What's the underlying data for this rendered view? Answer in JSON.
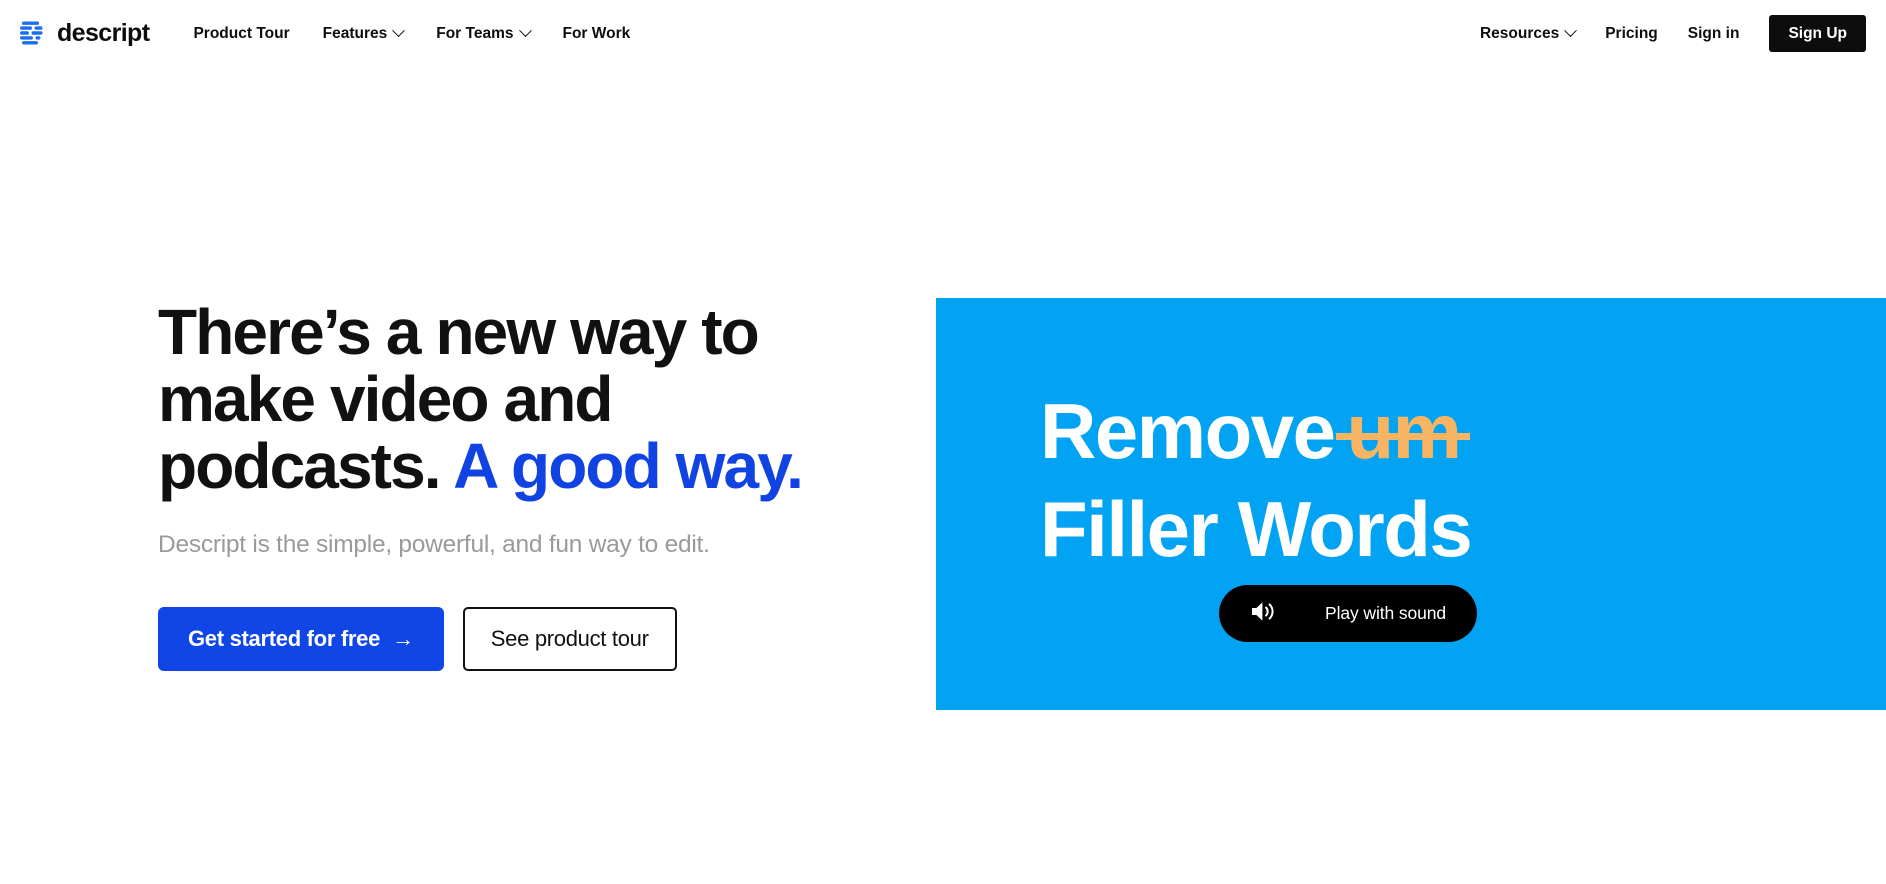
{
  "nav": {
    "brand": {
      "name": "descript",
      "logo_icon": "descript-waveform-logo"
    },
    "left_items": [
      {
        "label": "Product Tour",
        "has_dropdown": false
      },
      {
        "label": "Features",
        "has_dropdown": true,
        "icon": "chevron-down-icon"
      },
      {
        "label": "For Teams",
        "has_dropdown": true,
        "icon": "chevron-down-icon"
      },
      {
        "label": "For Work",
        "has_dropdown": false
      }
    ],
    "right_items": [
      {
        "label": "Resources",
        "has_dropdown": true,
        "icon": "chevron-down-icon"
      },
      {
        "label": "Pricing",
        "has_dropdown": false
      },
      {
        "label": "Sign in",
        "has_dropdown": false
      }
    ],
    "signup_label": "Sign Up"
  },
  "hero": {
    "headline_line1": "There’s a new way to",
    "headline_line2": "make video and",
    "headline_line3_plain": "podcasts.",
    "headline_line3_accent": "A good way.",
    "subhead": "Descript is the simple, powerful, and fun way to edit.",
    "primary_cta": "Get started for free",
    "primary_cta_arrow": "→",
    "secondary_cta": "See product tour"
  },
  "video_card": {
    "line1_white": "Remove",
    "line1_struck": "um",
    "line2": "Filler Words",
    "play_button_label": "Play with sound",
    "play_button_icon": "speaker-sound-icon"
  },
  "colors": {
    "brand_blue": "#1046e6",
    "card_blue": "#03a3f4",
    "accent_orange": "#f7b563",
    "text_dark": "#111111",
    "subhead_gray": "#9a9a9a",
    "black": "#0d0d0d",
    "white": "#ffffff"
  }
}
